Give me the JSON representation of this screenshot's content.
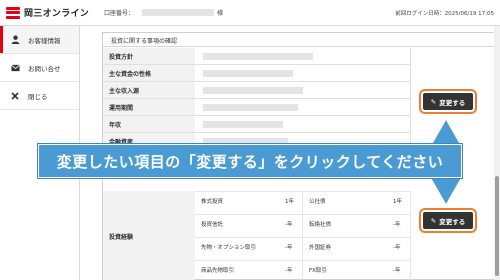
{
  "header": {
    "brand": "岡三オンライン",
    "account_label": "口座番号：",
    "account_suffix": "様",
    "last_login": "前回ログイン日時：2025/06/19 17:05"
  },
  "sidebar": {
    "items": [
      {
        "label": "お客様情報",
        "icon": "person-icon",
        "active": true
      },
      {
        "label": "お問い合せ",
        "icon": "mail-icon",
        "active": false
      },
      {
        "label": "閉じる",
        "icon": "close-icon",
        "active": false
      }
    ]
  },
  "panel": {
    "title": "投資に関する事項の確認",
    "rows": [
      {
        "label": "投資方針"
      },
      {
        "label": "主な資金の性格"
      },
      {
        "label": "主な収入源"
      },
      {
        "label": "運用期間"
      },
      {
        "label": "年収"
      },
      {
        "label": "金融資産"
      }
    ],
    "edit_label": "変更する",
    "experience": {
      "label": "投資経験",
      "items": [
        {
          "name": "株式投資",
          "value": "1年"
        },
        {
          "name": "公社債",
          "value": "1年"
        },
        {
          "name": "投資信託",
          "value": "-年"
        },
        {
          "name": "転換社債",
          "value": "-年"
        },
        {
          "name": "先物・オプション取引",
          "value": "-年"
        },
        {
          "name": "外国証券",
          "value": "-年"
        },
        {
          "name": "商品先物取引",
          "value": "-年"
        },
        {
          "name": "FX取引",
          "value": "-年"
        }
      ]
    }
  },
  "callout": {
    "text": "変更したい項目の「変更する」をクリックしてください"
  },
  "colors": {
    "brand_red": "#e60012",
    "callout_blue": "#4a9bd3",
    "highlight_orange": "#ed7d31",
    "button_dark": "#333333"
  }
}
